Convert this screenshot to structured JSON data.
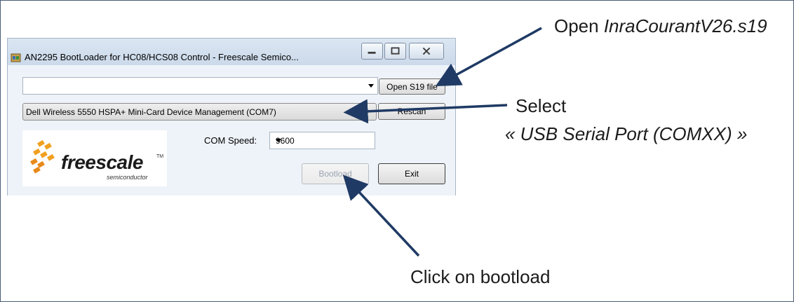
{
  "dialog": {
    "title": "AN2295 BootLoader for HC08/HCS08 Control - Freescale Semico...",
    "file_combo_value": "",
    "open_button": "Open S19 file",
    "port_selection": "Dell Wireless 5550 HSPA+ Mini-Card Device Management (COM7)",
    "rescan_button": "Rescan",
    "com_speed_label": "COM Speed:",
    "com_speed_value": "9600",
    "bootload_button": "Bootload",
    "exit_button": "Exit",
    "logo": {
      "word": "freescale",
      "sub": "semiconductor",
      "tm": "TM"
    }
  },
  "annotations": {
    "open_prefix": "Open ",
    "open_file": "InraCourantV26.s19",
    "select": "Select",
    "select_port": "« USB Serial Port (COMXX) »",
    "click": "Click on bootload"
  },
  "colors": {
    "arrow": "#1f3a64",
    "frame": "#4a5e78",
    "dialog_bg": "#eef3f9"
  }
}
